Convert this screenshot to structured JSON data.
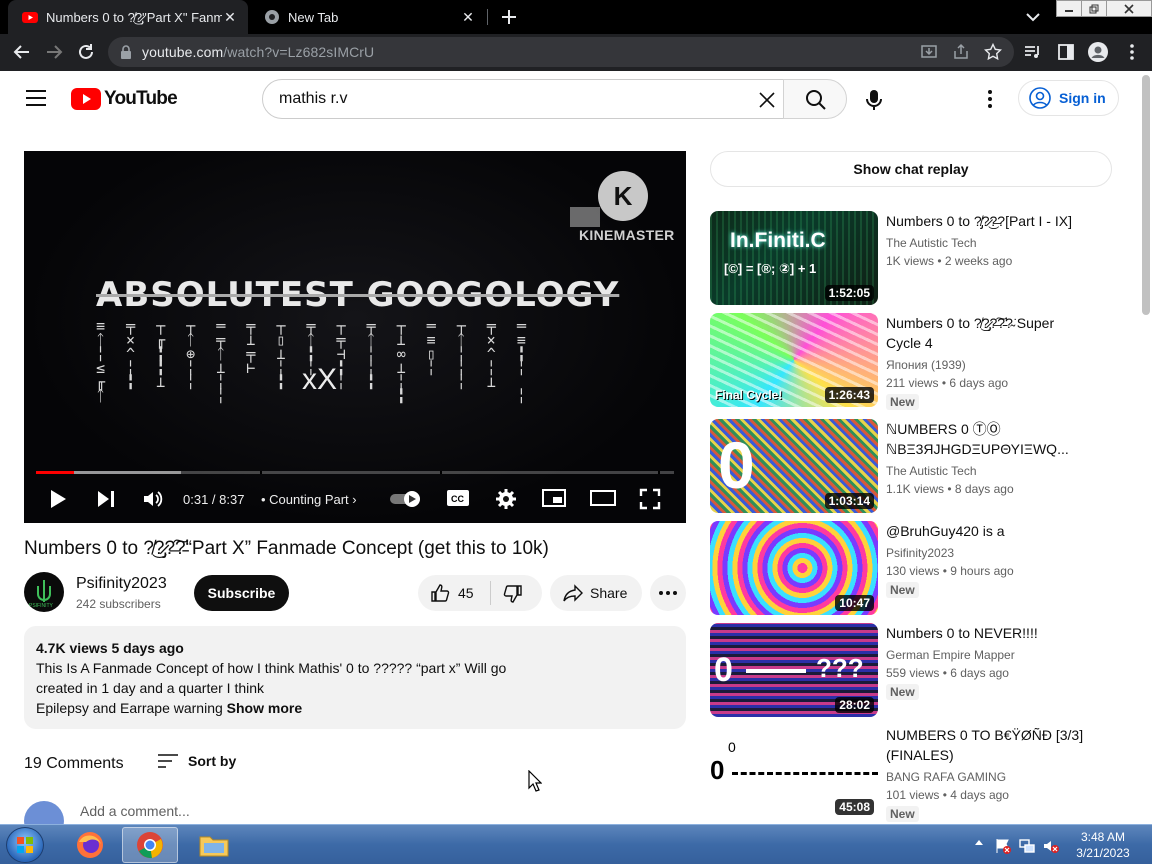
{
  "browser": {
    "tabs": [
      {
        "title": "Numbers 0 to ?̸͜?̷̡\"Part X\" Fanm",
        "active": true
      },
      {
        "title": "New Tab",
        "active": false
      }
    ],
    "url_host": "youtube.com",
    "url_path": "/watch?v=Lz682sIMCrU"
  },
  "masthead": {
    "logo_text": "YouTube",
    "search_query": "mathis r.v",
    "signin_label": "Sign in"
  },
  "player": {
    "overlay_watermark": "KINEMASTER",
    "overlay_logo_letter": "K",
    "overlay_title": "ABSOLUTEST GOOGOLOGY",
    "overlay_bottom_text": "xX",
    "time": "0:31 / 8:37",
    "chapter": "• Counting Part",
    "progress_fraction": 0.06
  },
  "video": {
    "title": "Numbers 0 to ?̸͜?̷̡?̶͠?̵̛“Part X” Fanmade Concept (get this to 10k)",
    "channel": "Psifinity2023",
    "subscribers": "242 subscribers",
    "subscribe_label": "Subscribe",
    "likes": "45",
    "share_label": "Share",
    "description": {
      "meta": "4.7K views  5 days ago",
      "line1": "This Is A Fanmade Concept of how I think Mathis' 0 to ????? “part x” Will go",
      "line2": "created in 1 day and a quarter I think",
      "line3": "Epilepsy and Earrape warning",
      "show_more": "Show more"
    },
    "comments_count": "19 Comments",
    "sort_by": "Sort by",
    "add_comment": "Add a comment..."
  },
  "sidebar": {
    "chat_replay": "Show chat replay",
    "recommendations": [
      {
        "title": "Numbers 0 to ?̸̡?̷͜?̶?[Part I - IX]",
        "channel": "The Autistic Tech",
        "views": "1K views",
        "age": "2 weeks ago",
        "duration": "1:52:05",
        "badge": "",
        "thumb_text": "In.Finiti.C",
        "thumb_sub": "[©] = [®; ②] + 1"
      },
      {
        "title": "Numbers 0 to ?̸͜?̷̡?̶͠?̵̛?̴͘ Super Cycle 4",
        "channel": "Япония (1939)",
        "views": "211 views",
        "age": "6 days ago",
        "duration": "1:26:43",
        "badge": "New",
        "thumb_text": "Final Cycle!",
        "thumb_sub": ""
      },
      {
        "title": "ℕUMBERS 0 ⓉⓄ ℕΒΞ3ЯJHGDΞUPΘΥΙΞWQ...",
        "channel": "The Autistic Tech",
        "views": "1.1K views",
        "age": "8 days ago",
        "duration": "1:03:14",
        "badge": "",
        "thumb_text": "0",
        "thumb_sub": ""
      },
      {
        "title": "@BruhGuy420 is a",
        "channel": "Psifinity2023",
        "views": "130 views",
        "age": "9 hours ago",
        "duration": "10:47",
        "badge": "New",
        "thumb_text": "",
        "thumb_sub": ""
      },
      {
        "title": "Numbers 0 to NEVER!!!!",
        "channel": "German Empire Mapper",
        "views": "559 views",
        "age": "6 days ago",
        "duration": "28:02",
        "badge": "New",
        "thumb_text": "0",
        "thumb_sub": "???"
      },
      {
        "title": "NUMBERS 0 TO B€ŸØÑÐ [3/3] (FINALES)",
        "channel": "BANG RAFA GAMING",
        "views": "101 views",
        "age": "4 days ago",
        "duration": "45:08",
        "badge": "New",
        "thumb_text": "0",
        "thumb_sub": "0"
      }
    ]
  },
  "taskbar": {
    "time": "3:48 AM",
    "date": "3/21/2023"
  },
  "colors": {
    "yt_red": "#ff0000",
    "link_blue": "#065fd4",
    "chrome_dark": "#202124"
  }
}
